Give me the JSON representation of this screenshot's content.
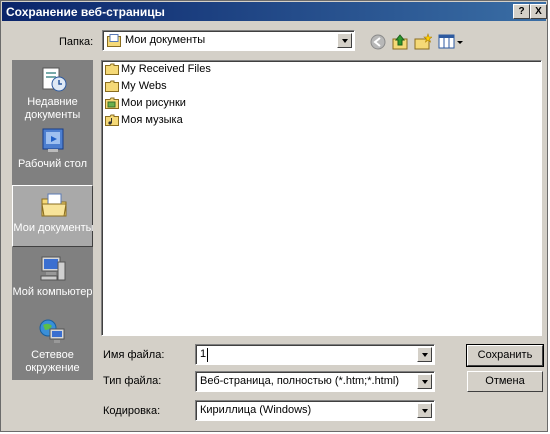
{
  "window": {
    "title": "Сохранение веб-страницы",
    "help_glyph": "?",
    "close_glyph": "X"
  },
  "folder": {
    "label": "Папка:",
    "value": "Мои документы"
  },
  "places": [
    {
      "label": "Недавние документы",
      "icon": "recent-documents-icon"
    },
    {
      "label": "Рабочий стол",
      "icon": "desktop-icon"
    },
    {
      "label": "Мои документы",
      "icon": "my-documents-icon"
    },
    {
      "label": "Мой компьютер",
      "icon": "my-computer-icon"
    },
    {
      "label": "Сетевое окружение",
      "icon": "network-icon"
    }
  ],
  "files": [
    {
      "name": "My Received Files",
      "icon": "folder-icon"
    },
    {
      "name": "My Webs",
      "icon": "folder-icon"
    },
    {
      "name": "Мои рисунки",
      "icon": "special-folder-icon"
    },
    {
      "name": "Моя музыка",
      "icon": "special-folder-icon"
    }
  ],
  "filename": {
    "label": "Имя файла:",
    "value": "1"
  },
  "filetype": {
    "label": "Тип файла:",
    "value": "Веб-страница, полностью (*.htm;*.html)"
  },
  "encoding": {
    "label": "Кодировка:",
    "value": "Кириллица (Windows)"
  },
  "buttons": {
    "save": "Сохранить",
    "cancel": "Отмена"
  }
}
